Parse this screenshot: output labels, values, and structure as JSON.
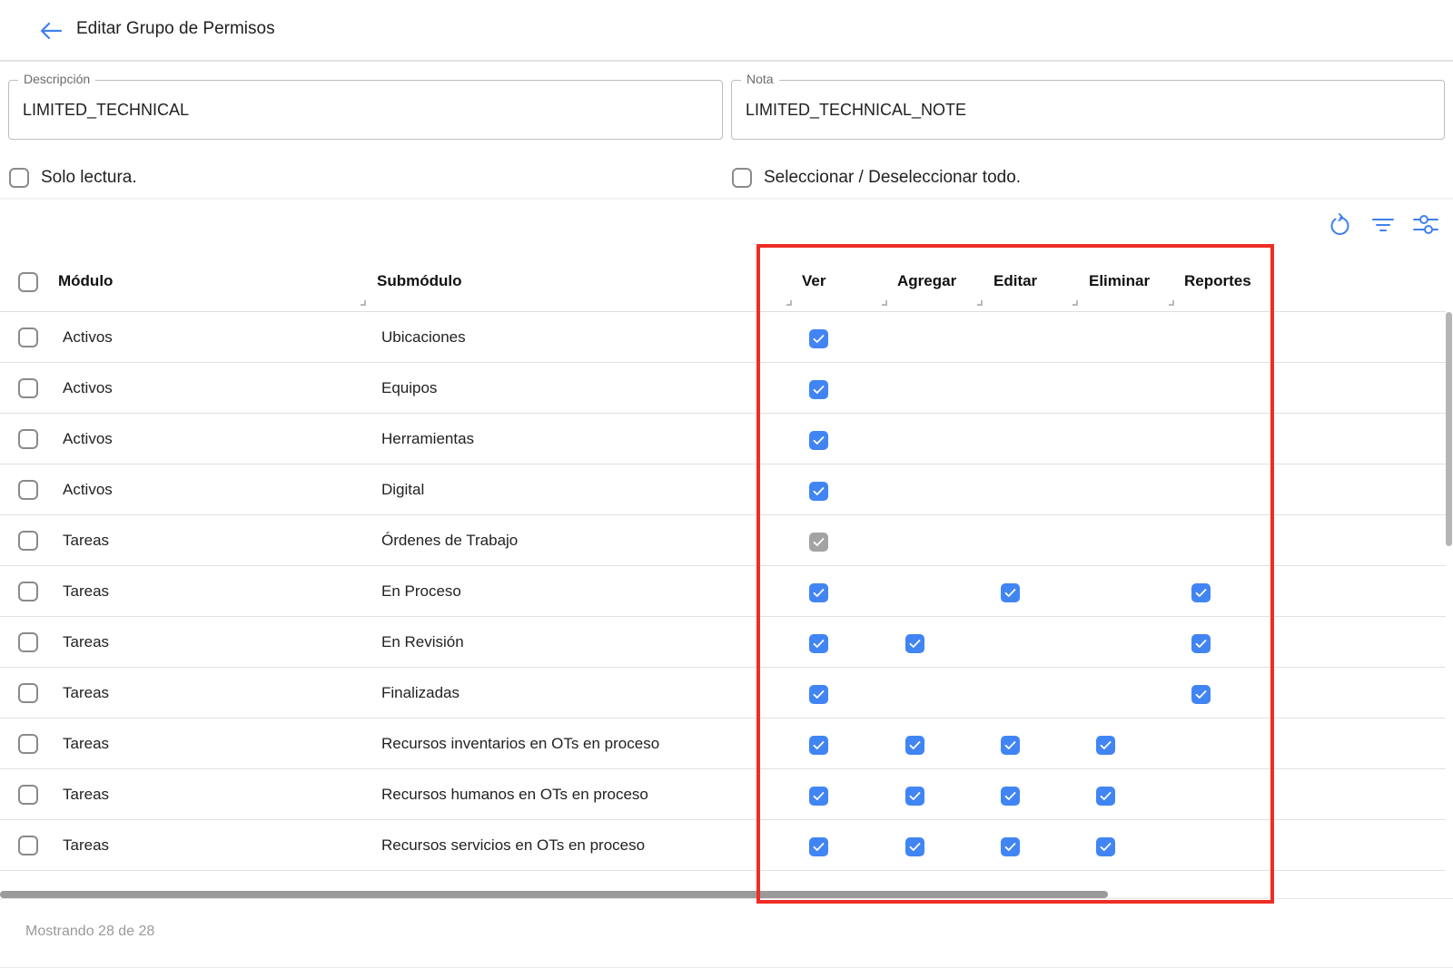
{
  "header": {
    "title": "Editar Grupo de Permisos"
  },
  "form": {
    "descripcion_label": "Descripción",
    "descripcion_value": "LIMITED_TECHNICAL",
    "nota_label": "Nota",
    "nota_value": "LIMITED_TECHNICAL_NOTE",
    "solo_lectura": {
      "label": "Solo lectura.",
      "checked": false
    },
    "seleccionar_todo": {
      "label": "Seleccionar / Deseleccionar todo.",
      "checked": false
    }
  },
  "toolbar": {
    "icons": [
      "refresh-icon",
      "filter-icon",
      "settings-sliders-icon"
    ]
  },
  "table": {
    "columns": [
      "Módulo",
      "Submódulo",
      "Ver",
      "Agregar",
      "Editar",
      "Eliminar",
      "Reportes"
    ],
    "rows": [
      {
        "modulo": "Activos",
        "submodulo": "Ubicaciones",
        "ver": "checked",
        "agregar": "",
        "editar": "",
        "eliminar": "",
        "reportes": ""
      },
      {
        "modulo": "Activos",
        "submodulo": "Equipos",
        "ver": "checked",
        "agregar": "",
        "editar": "",
        "eliminar": "",
        "reportes": ""
      },
      {
        "modulo": "Activos",
        "submodulo": "Herramientas",
        "ver": "checked",
        "agregar": "",
        "editar": "",
        "eliminar": "",
        "reportes": ""
      },
      {
        "modulo": "Activos",
        "submodulo": "Digital",
        "ver": "checked",
        "agregar": "",
        "editar": "",
        "eliminar": "",
        "reportes": ""
      },
      {
        "modulo": "Tareas",
        "submodulo": "Órdenes de Trabajo",
        "ver": "disabled",
        "agregar": "",
        "editar": "",
        "eliminar": "",
        "reportes": ""
      },
      {
        "modulo": "Tareas",
        "submodulo": "En Proceso",
        "ver": "checked",
        "agregar": "",
        "editar": "checked",
        "eliminar": "",
        "reportes": "checked"
      },
      {
        "modulo": "Tareas",
        "submodulo": "En Revisión",
        "ver": "checked",
        "agregar": "checked",
        "editar": "",
        "eliminar": "",
        "reportes": "checked"
      },
      {
        "modulo": "Tareas",
        "submodulo": "Finalizadas",
        "ver": "checked",
        "agregar": "",
        "editar": "",
        "eliminar": "",
        "reportes": "checked"
      },
      {
        "modulo": "Tareas",
        "submodulo": "Recursos inventarios en OTs en proceso",
        "ver": "checked",
        "agregar": "checked",
        "editar": "checked",
        "eliminar": "checked",
        "reportes": ""
      },
      {
        "modulo": "Tareas",
        "submodulo": "Recursos humanos en OTs en proceso",
        "ver": "checked",
        "agregar": "checked",
        "editar": "checked",
        "eliminar": "checked",
        "reportes": ""
      },
      {
        "modulo": "Tareas",
        "submodulo": "Recursos servicios en OTs en proceso",
        "ver": "checked",
        "agregar": "checked",
        "editar": "checked",
        "eliminar": "checked",
        "reportes": ""
      }
    ]
  },
  "footer": {
    "status": "Mostrando 28 de 28"
  },
  "colors": {
    "accent": "#4185f4",
    "highlight": "#ee2e24",
    "disabled_check": "#a3a3a3"
  }
}
